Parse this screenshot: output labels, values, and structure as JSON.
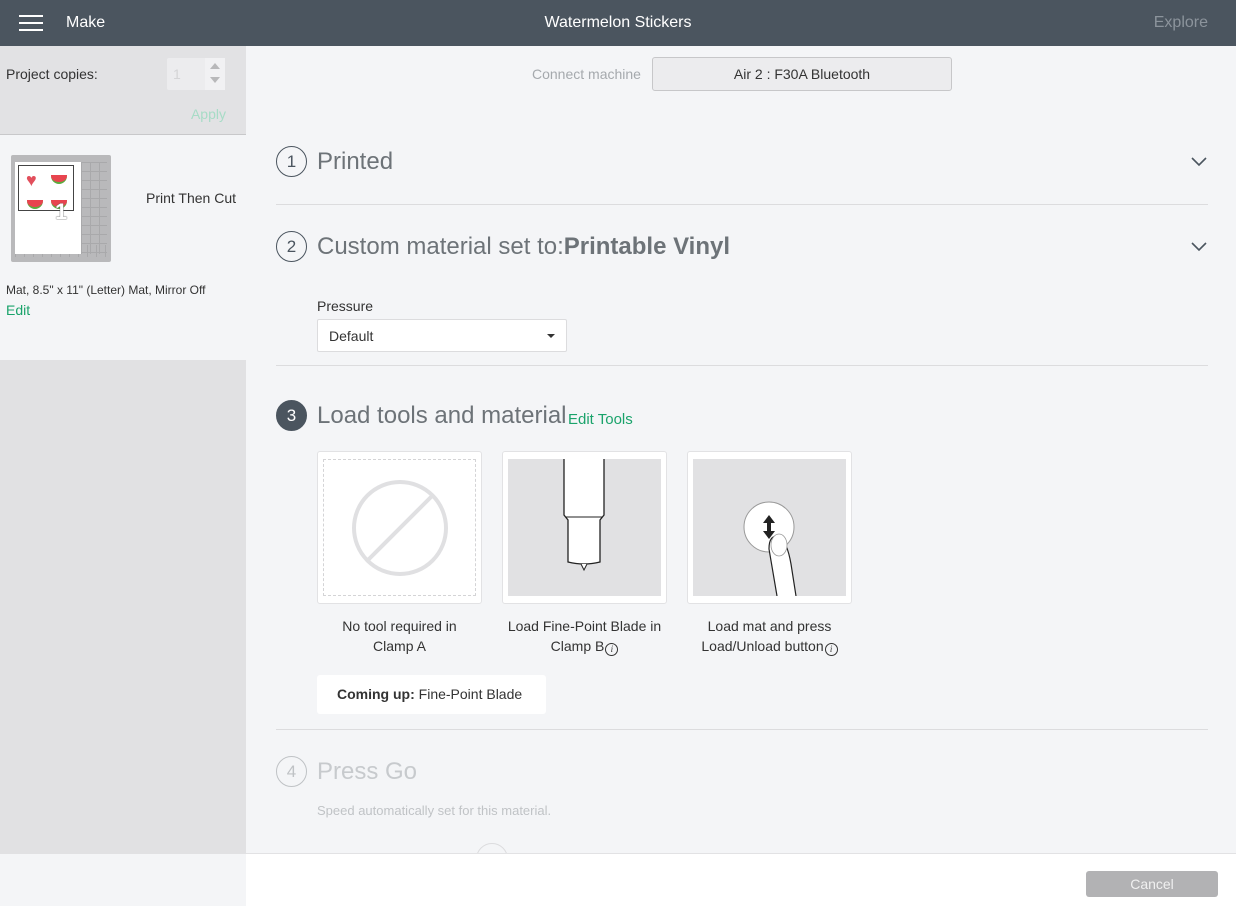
{
  "topbar": {
    "menu_icon": "hamburger-icon",
    "section": "Make",
    "title": "Watermelon Stickers",
    "explore": "Explore"
  },
  "sidebar": {
    "copies_label": "Project copies:",
    "copies_value": "1",
    "apply_label": "Apply",
    "mat": {
      "number": "1",
      "mode": "Print Then Cut",
      "info": "Mat, 8.5\" x 11\" (Letter) Mat, Mirror Off",
      "edit_label": "Edit"
    }
  },
  "main": {
    "connect_label": "Connect machine",
    "machine": "Air 2 : F30A Bluetooth",
    "steps": [
      {
        "number": "1",
        "title": "Printed"
      },
      {
        "number": "2",
        "title_prefix": "Custom material set to:",
        "title_bold": "Printable Vinyl"
      },
      {
        "number": "3",
        "title": "Load tools and material",
        "link": "Edit Tools"
      },
      {
        "number": "4",
        "title": "Press Go",
        "subtitle": "Speed automatically set for this material."
      }
    ],
    "pressure": {
      "label": "Pressure",
      "value": "Default"
    },
    "tools": [
      {
        "caption_line1": "No tool required in",
        "caption_line2": "Clamp A",
        "icon": "no-tool-icon"
      },
      {
        "caption_line1": "Load Fine-Point Blade in",
        "caption_line2": "Clamp B",
        "icon": "fine-point-blade-icon",
        "info": true
      },
      {
        "caption_line1": "Load mat and press",
        "caption_line2": "Load/Unload button",
        "icon": "load-unload-button-icon",
        "info": true
      }
    ],
    "coming_up": {
      "label": "Coming up:",
      "value": "Fine-Point Blade"
    }
  },
  "footer": {
    "cancel_label": "Cancel"
  },
  "colors": {
    "topbar": "#4b555f",
    "accent_green": "#1aa36b",
    "background": "#f4f5f7"
  }
}
